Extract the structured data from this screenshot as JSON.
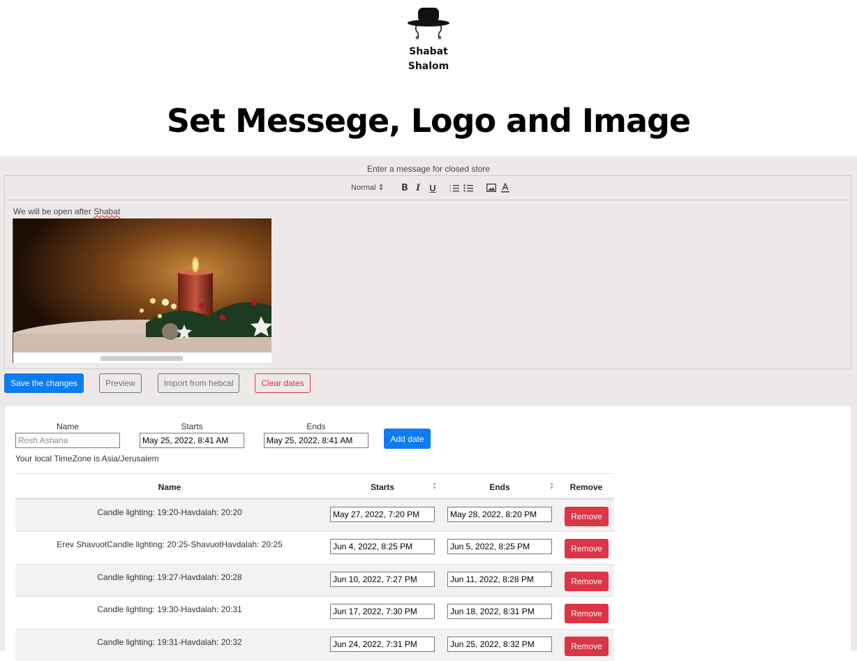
{
  "logo": {
    "line1": "Shabat",
    "line2": "Shalom"
  },
  "page_title": "Set Messege, Logo and Image",
  "editor": {
    "label": "Enter a message for closed store",
    "toolbar": {
      "format_select": "Normal"
    },
    "message_prefix": "We will be open after ",
    "message_word": "Shabat"
  },
  "actions": {
    "save": "Save the changes",
    "preview": "Preview",
    "import": "Import from hebcal",
    "clear": "Clear dates"
  },
  "form": {
    "name_label": "Name",
    "starts_label": "Starts",
    "ends_label": "Ends",
    "name_placeholder": "Rosh Ashana",
    "starts_value": "May 25, 2022, 8:41 AM",
    "ends_value": "May 25, 2022, 8:41 AM",
    "add_button": "Add date",
    "timezone_text": "Your local TimeZone is Asia/Jerusalem"
  },
  "table": {
    "headers": {
      "name": "Name",
      "starts": "Starts",
      "ends": "Ends",
      "remove": "Remove"
    },
    "rows": [
      {
        "name": "Candle lighting: 19:20-Havdalah: 20:20",
        "starts": "May 27, 2022, 7:20 PM",
        "ends": "May 28, 2022, 8:20 PM",
        "action": "Remove"
      },
      {
        "name": "Erev ShavuotCandle lighting: 20:25-ShavuotHavdalah: 20:25",
        "starts": "Jun 4, 2022, 8:25 PM",
        "ends": "Jun 5, 2022, 8:25 PM",
        "action": "Remove"
      },
      {
        "name": "Candle lighting: 19:27-Havdalah: 20:28",
        "starts": "Jun 10, 2022, 7:27 PM",
        "ends": "Jun 11, 2022, 8:28 PM",
        "action": "Remove"
      },
      {
        "name": "Candle lighting: 19:30-Havdalah: 20:31",
        "starts": "Jun 17, 2022, 7:30 PM",
        "ends": "Jun 18, 2022, 8:31 PM",
        "action": "Remove"
      },
      {
        "name": "Candle lighting: 19:31-Havdalah: 20:32",
        "starts": "Jun 24, 2022, 7:31 PM",
        "ends": "Jun 25, 2022, 8:32 PM",
        "action": "Remove"
      }
    ]
  }
}
